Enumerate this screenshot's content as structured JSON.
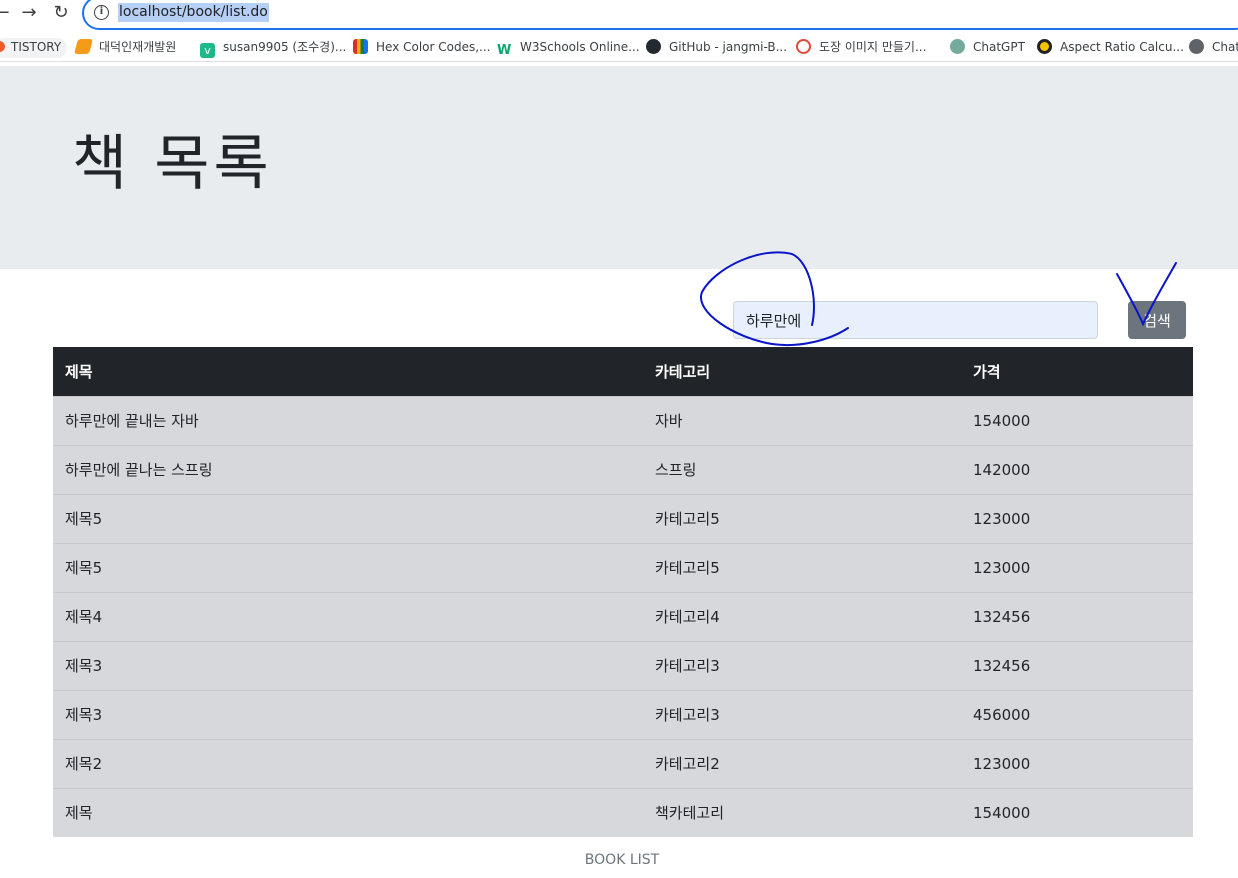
{
  "browser": {
    "url": "localhost/book/list.do",
    "bookmarks": [
      {
        "label": "TISTORY",
        "color": "#f25c2c"
      },
      {
        "label": "대덕인재개발원",
        "color": "#f59b1a"
      },
      {
        "label": "susan9905 (조수경)...",
        "color": "#1fb88a"
      },
      {
        "label": "Hex Color Codes,...",
        "color": "#d93025"
      },
      {
        "label": "W3Schools Online...",
        "color": "#04aa6d"
      },
      {
        "label": "GitHub - jangmi-B...",
        "color": "#24292f"
      },
      {
        "label": "도장 이미지 만들기...",
        "color": "#e2483a"
      },
      {
        "label": "ChatGPT",
        "color": "#74aa9c"
      },
      {
        "label": "Aspect Ratio Calcu...",
        "color": "#f5c400"
      },
      {
        "label": "Chat",
        "color": "#5f6368"
      }
    ]
  },
  "page": {
    "title": "책 목록",
    "search": {
      "value": "하루만에",
      "button_label": "검색"
    },
    "table": {
      "headers": [
        "제목",
        "카테고리",
        "가격"
      ],
      "rows": [
        [
          "하루만에 끝내는 자바",
          "자바",
          "154000"
        ],
        [
          "하루만에 끝나는 스프링",
          "스프링",
          "142000"
        ],
        [
          "제목5",
          "카테고리5",
          "123000"
        ],
        [
          "제목5",
          "카테고리5",
          "123000"
        ],
        [
          "제목4",
          "카테고리4",
          "132456"
        ],
        [
          "제목3",
          "카테고리3",
          "132456"
        ],
        [
          "제목3",
          "카테고리3",
          "456000"
        ],
        [
          "제목2",
          "카테고리2",
          "123000"
        ],
        [
          "제목",
          "책카테고리",
          "154000"
        ]
      ]
    },
    "footer": "BOOK LIST"
  },
  "colors": {
    "jumbotron": "#e9ecef",
    "table_header": "#212529",
    "table_row": "#d6d8db",
    "search_button": "#6c757d",
    "annotation_ink": "#0a14c8"
  }
}
